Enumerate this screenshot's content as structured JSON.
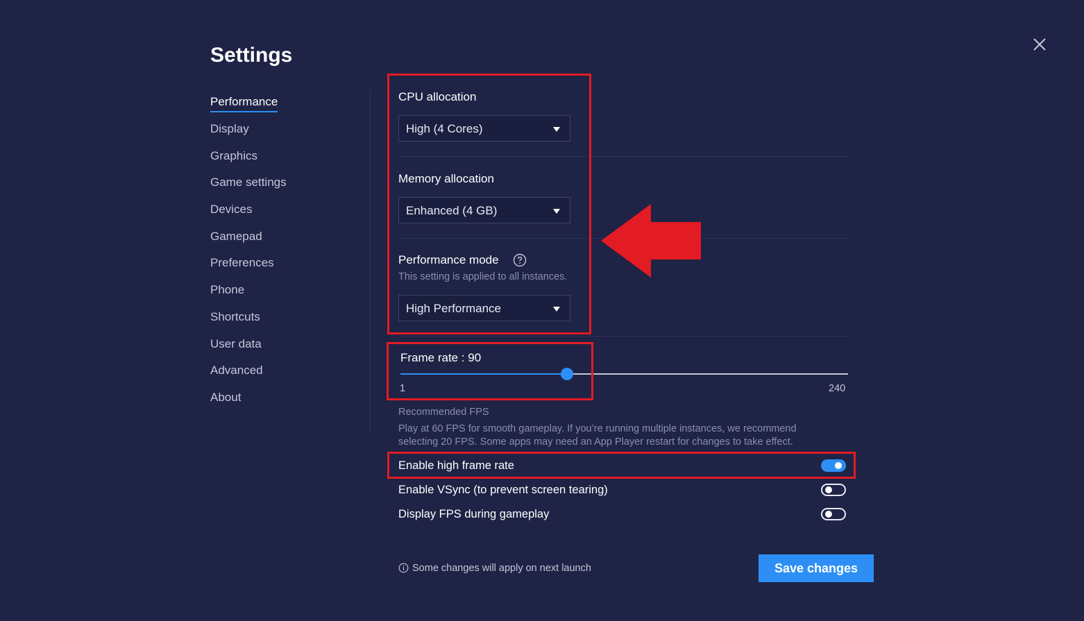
{
  "title": "Settings",
  "nav": {
    "items": [
      {
        "label": "Performance",
        "active": true
      },
      {
        "label": "Display"
      },
      {
        "label": "Graphics"
      },
      {
        "label": "Game settings"
      },
      {
        "label": "Devices"
      },
      {
        "label": "Gamepad"
      },
      {
        "label": "Preferences"
      },
      {
        "label": "Phone"
      },
      {
        "label": "Shortcuts"
      },
      {
        "label": "User data"
      },
      {
        "label": "Advanced"
      },
      {
        "label": "About"
      }
    ]
  },
  "performance": {
    "cpu": {
      "label": "CPU allocation",
      "value": "High (4 Cores)"
    },
    "memory": {
      "label": "Memory allocation",
      "value": "Enhanced (4 GB)"
    },
    "mode": {
      "label": "Performance mode",
      "hint": "This setting is applied to all instances.",
      "value": "High Performance"
    },
    "frame_rate": {
      "label": "Frame rate : 90",
      "min": "1",
      "max": "240",
      "value": 90,
      "min_value": 1,
      "max_value": 240
    },
    "recommended": {
      "title": "Recommended FPS",
      "line1": "Play at 60 FPS for smooth gameplay. If you’re running multiple instances, we recommend",
      "line2": "selecting 20 FPS. Some apps may need an App Player restart for changes to take effect."
    },
    "toggles": {
      "high_frame_rate": {
        "label": "Enable high frame rate",
        "on": true
      },
      "vsync": {
        "label": "Enable VSync (to prevent screen tearing)",
        "on": false
      },
      "display_fps": {
        "label": "Display FPS during gameplay",
        "on": false
      }
    }
  },
  "footer": {
    "note": "Some changes will apply on next launch",
    "save_label": "Save changes"
  },
  "colors": {
    "background": "#1f2345",
    "accent": "#2d8ff5",
    "highlight": "#e31b23"
  },
  "icons": [
    "close-icon",
    "help-icon",
    "caret-down-icon",
    "info-icon",
    "arrow-left-icon"
  ]
}
